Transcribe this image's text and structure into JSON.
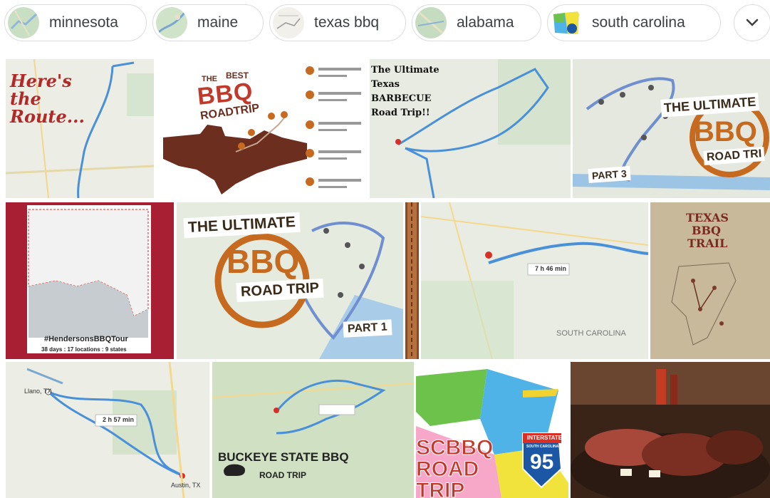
{
  "chips": [
    {
      "label": "minnesota"
    },
    {
      "label": "maine"
    },
    {
      "label": "texas bbq"
    },
    {
      "label": "alabama"
    },
    {
      "label": "south carolina"
    }
  ],
  "more_icon": "chevron-down-icon",
  "images": {
    "route": {
      "text": "Here's the Route..."
    },
    "best_bbq": {
      "line1": "THE",
      "line2": "BEST",
      "line3": "BBQ",
      "line4": "ROADTRIP"
    },
    "texas_barbecue": {
      "text": "The Ultimate Texas BARBECUE Road Trip!!"
    },
    "ultimate_part3": {
      "title": "THE ULTIMATE",
      "bbq": "BBQ",
      "road": "ROAD TRI",
      "part": "PART 3"
    },
    "hendersons": {
      "tag": "#HendersonsBBQTour",
      "stats": "38 days : 17 locations : 9 states"
    },
    "ultimate_part1": {
      "title": "THE ULTIMATE",
      "bbq": "BBQ",
      "road": "ROAD TRIP",
      "part": "PART 1"
    },
    "nc_route": {
      "stat": "7 h 46 min",
      "region": "SOUTH CAROLINA"
    },
    "texas_trail": {
      "line1": "TEXAS",
      "line2": "BBQ",
      "line3": "TRAIL"
    },
    "llano_route": {
      "stat": "2 h 57 min",
      "city1": "Llano, TX",
      "city2": "Austin, TX"
    },
    "buckeye": {
      "title": "BUCKEYE STATE BBQ",
      "subtitle": "ROAD TRIP"
    },
    "scbbq": {
      "line1": "SCBBQ",
      "line2": "ROAD",
      "line3": "TRIP",
      "shield_top": "INTERSTATE",
      "shield_state": "SOUTH CAROLINA",
      "shield_num": "95"
    },
    "ribs": {}
  },
  "colors": {
    "chip_border": "#dadce0",
    "chip_text": "#3c4043",
    "route_blue": "#4a90d9",
    "bbq_brown": "#6b2e1f",
    "bbq_orange": "#c56a1f"
  }
}
